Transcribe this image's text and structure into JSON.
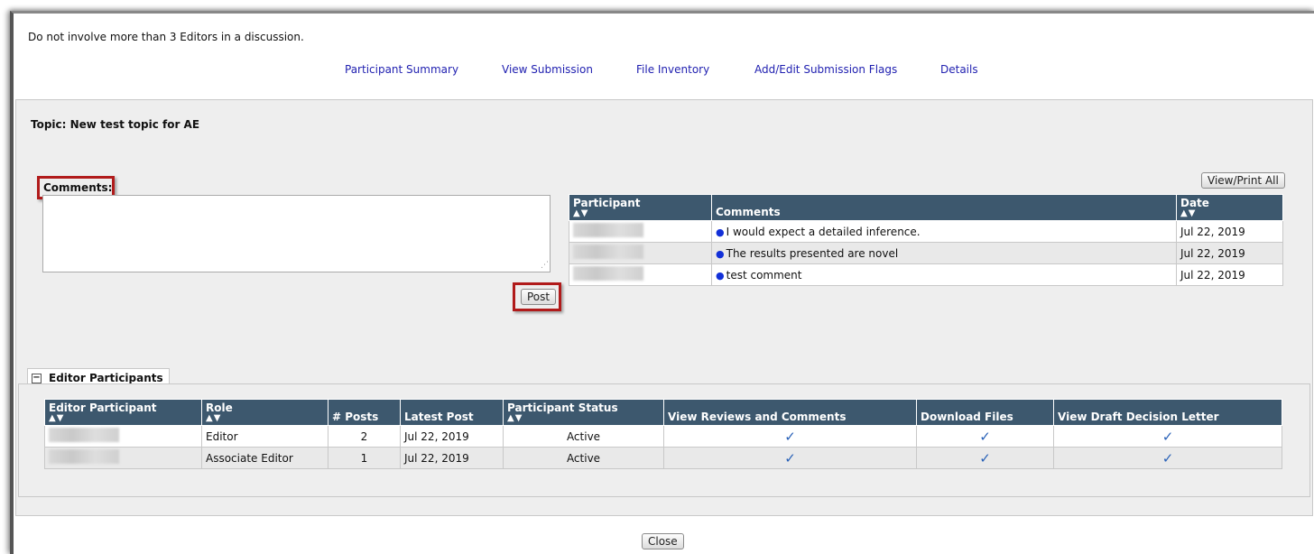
{
  "notice": "Do not involve more than 3 Editors in a discussion.",
  "nav": {
    "participant_summary": "Participant Summary",
    "view_submission": "View Submission",
    "file_inventory": "File Inventory",
    "submission_flags": "Add/Edit Submission Flags",
    "details": "Details"
  },
  "topic": "Topic: New test topic for AE",
  "comments_label": "Comments:",
  "comments_value": "",
  "post_label": "Post",
  "view_print_label": "View/Print All",
  "comments_table": {
    "headers": {
      "participant": "Participant",
      "comments": "Comments",
      "date": "Date"
    },
    "sort_glyphs": "▲▼",
    "rows": [
      {
        "comment": "I would expect a detailed inference.",
        "date": "Jul 22, 2019"
      },
      {
        "comment": "The results presented are novel",
        "date": "Jul 22, 2019"
      },
      {
        "comment": "test comment",
        "date": "Jul 22, 2019"
      }
    ]
  },
  "editor_section": {
    "title": "Editor Participants",
    "toggle": "−",
    "headers": {
      "participant": "Editor Participant",
      "role": "Role",
      "posts": "# Posts",
      "latest": "Latest Post",
      "status": "Participant Status",
      "view_reviews": "View Reviews and Comments",
      "download": "Download Files",
      "draft_letter": "View Draft Decision Letter"
    },
    "check_glyph": "✓",
    "rows": [
      {
        "role": "Editor",
        "posts": "2",
        "latest": "Jul 22, 2019",
        "status": "Active"
      },
      {
        "role": "Associate Editor",
        "posts": "1",
        "latest": "Jul 22, 2019",
        "status": "Active"
      }
    ]
  },
  "close_label": "Close",
  "colors": {
    "header_bg": "#3d586e",
    "link": "#1f1fb0",
    "highlight": "#b11b1b",
    "bullet": "#1230d8",
    "check": "#2a62b8"
  }
}
